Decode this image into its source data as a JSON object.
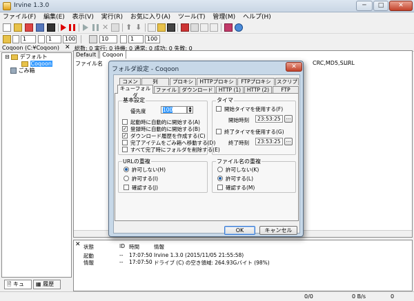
{
  "window": {
    "title": "Irvine 1.3.0",
    "btn_min": "─",
    "btn_max": "□",
    "btn_close": "✕"
  },
  "menu": [
    "ファイル(F)",
    "編集(E)",
    "表示(V)",
    "実行(R)",
    "お気に入り(A)",
    "ツール(T)",
    "管理(M)",
    "ヘルプ(H)"
  ],
  "toolbar2": {
    "spin1": "1",
    "spin2": "1",
    "spin3": "100",
    "spin4": "10",
    "spin5": "1",
    "spin6": "100"
  },
  "left": {
    "header": "Coqoon (C:¥Coqoon)",
    "close": "✕",
    "tree": {
      "root": "デフォルト",
      "child": "Coqoon",
      "trash": "ごみ箱"
    },
    "tabs": {
      "queue": "キュー",
      "history": "履歴"
    }
  },
  "status_top": "総数: 0 実行: 0 待機: 0 通常: 0 成功: 0 失敗: 0",
  "queue_tabs": [
    "Default",
    "Coqoon"
  ],
  "columns": {
    "filename": "ファイル名",
    "crc": "CRC,MD5,S...",
    "url": "URL"
  },
  "log": {
    "close": "✕",
    "headers": {
      "state": "状態",
      "id": "ID",
      "time": "時間",
      "info": "情報"
    },
    "rows": [
      {
        "state": "起動",
        "id": "--",
        "time": "17:07:50",
        "info": "Irvine 1.3.0 (2015/11/05 21:55:58)"
      },
      {
        "state": "情報",
        "id": "--",
        "time": "17:07:50",
        "info": "ドライブ (C) の空き領域: 264.93Gバイト (98%)"
      }
    ]
  },
  "statusbar": {
    "count": "0/0",
    "speed": "0 B/s",
    "num": "0"
  },
  "dialog": {
    "title": "フォルダ設定 - Coqoon",
    "close": "✕",
    "tabs_row1": [
      "コメント",
      "列",
      "プロキシ",
      "HTTPプロキシ",
      "FTPプロキシ",
      "スクリプト"
    ],
    "tabs_row2": [
      "キューフォルダ",
      "ファイル",
      "ダウンロード",
      "HTTP (1)",
      "HTTP (2)",
      "FTP"
    ],
    "basic": {
      "label": "基本設定",
      "priority_label": "優先度",
      "priority_value": "100",
      "checks": [
        {
          "label": "起動時に自動的に開始する(A)",
          "checked": false
        },
        {
          "label": "登録時に自動的に開始する(B)",
          "checked": true
        },
        {
          "label": "ダウンロード履歴を作成する(C)",
          "checked": true
        },
        {
          "label": "完了アイテムをごみ箱へ移動する(D)",
          "checked": false
        },
        {
          "label": "すべて完了時にフォルダを削除する(E)",
          "checked": false
        }
      ]
    },
    "timer": {
      "label": "タイマ",
      "start_check": "開始タイマを使用する(F)",
      "start_time_label": "開始時刻",
      "start_time": "23:53:25",
      "end_check": "終了タイマを使用する(G)",
      "end_time_label": "終了時刻",
      "end_time": "23:53:25",
      "browse": "..."
    },
    "url_dup": {
      "label": "URLの重複",
      "options": [
        {
          "label": "許可しない(H)",
          "selected": true
        },
        {
          "label": "許可する(I)",
          "selected": false
        }
      ],
      "confirm": "確認する(J)"
    },
    "file_dup": {
      "label": "ファイル名の重複",
      "options": [
        {
          "label": "許可しない(K)",
          "selected": false
        },
        {
          "label": "許可する(L)",
          "selected": true
        }
      ],
      "confirm": "確認する(M)"
    },
    "ok": "OK",
    "cancel": "キャンセル"
  }
}
